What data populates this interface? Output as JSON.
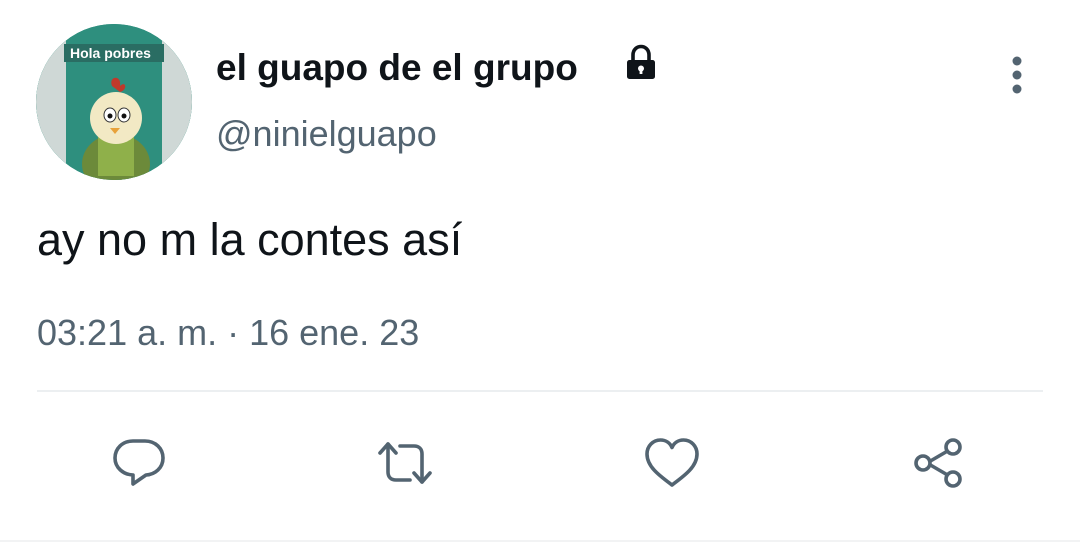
{
  "tweet": {
    "author": {
      "display_name": "el guapo de el grupo",
      "handle": "@ninielguapo",
      "protected": true,
      "avatar_caption": "Hola pobres"
    },
    "text": "ay no m la contes así",
    "timestamp": "03:21 a. m. · 16 ene. 23"
  },
  "actions": {
    "reply_icon": "speech-bubble-icon",
    "retweet_icon": "retweet-arrows-icon",
    "like_icon": "heart-icon",
    "share_icon": "share-nodes-icon"
  },
  "colors": {
    "text_primary": "#0f1419",
    "text_secondary": "#536471",
    "icon_gray": "#536471",
    "divider": "#eceff1",
    "avatar_background": "#2e8f7e"
  }
}
